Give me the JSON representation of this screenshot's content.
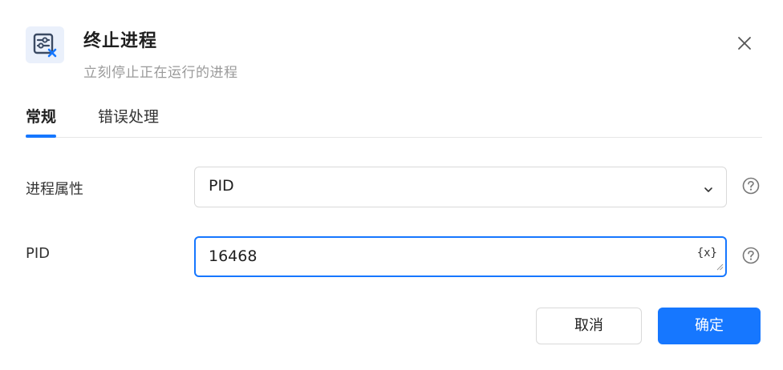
{
  "dialog": {
    "title": "终止进程",
    "subtitle": "立刻停止正在运行的进程",
    "header_icon": "terminate-process-icon",
    "close_icon": "close-icon"
  },
  "tabs": [
    {
      "label": "常规",
      "active": true
    },
    {
      "label": "错误处理",
      "active": false
    }
  ],
  "form": {
    "process_attribute": {
      "label": "进程属性",
      "value": "PID"
    },
    "pid": {
      "label": "PID",
      "value": "16468",
      "variable_button": "{x}"
    }
  },
  "footer": {
    "cancel_label": "取消",
    "confirm_label": "确定"
  },
  "colors": {
    "accent": "#1677ff",
    "icon_bg": "#eaf0fb",
    "subtitle": "#9a9a9a"
  }
}
